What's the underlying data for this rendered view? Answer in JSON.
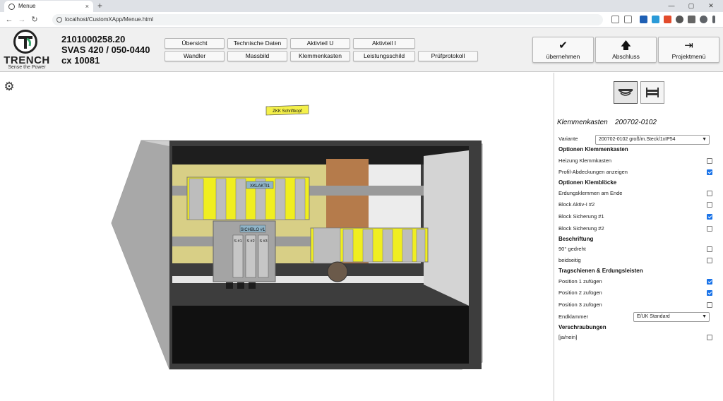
{
  "browser": {
    "tab_title": "Menue",
    "tab_close": "×",
    "new_tab": "+",
    "url": "localhost/CustomXApp/Menue.html",
    "controls": {
      "minimize": "—",
      "maximize": "▢",
      "close": "✕"
    }
  },
  "app": {
    "logo": {
      "word": "TRENCH",
      "tagline": "Sense the Power"
    },
    "ids": [
      "2101000258.20",
      "SVAS 420 / 050-0440",
      "cx 10081"
    ],
    "nav_row1": [
      "Übersicht",
      "Technische Daten",
      "Aktivteil U",
      "Aktivteil I"
    ],
    "nav_row2": [
      "Wandler",
      "Massbild",
      "Klemmenkasten",
      "Leistungsschild",
      "Prüfprotokoll"
    ],
    "actions": [
      {
        "label": "übernehmen",
        "icon": "checkmark-icon"
      },
      {
        "label": "Abschluss",
        "icon": "arrow-up-icon"
      },
      {
        "label": "Projektmenü",
        "icon": "exit-icon"
      }
    ]
  },
  "viewport": {
    "labels": {
      "tag_top": "ZKK Schriftkopf",
      "block_a": "XKLAKTI1",
      "block_b": "SICHBLO #1",
      "fuse_1": "S #1",
      "fuse_2": "S #2",
      "fuse_3": "S #3"
    }
  },
  "panel": {
    "title": "Klemmenkasten",
    "title_code": "200702-0102",
    "variante_label": "Variante",
    "variante_value": "200702-0102 groß/m.Steck/1xIP54",
    "sections": {
      "optionen": "Optionen Klemmenkasten",
      "klemmbloecke": "Optionen Klemblöcke",
      "beschriftung": "Beschriftung",
      "tragschienen": "Tragschienen & Erdungsleisten",
      "verschraubungen": "Verschraubungen"
    },
    "options": {
      "heizung": {
        "label": "Heizung Klemmkasten",
        "checked": false
      },
      "profil": {
        "label": "Profil-Abdeckungen anzeigen",
        "checked": true
      },
      "erdung": {
        "label": "Erdungsklemmen am Ende",
        "checked": false
      },
      "aktiv2": {
        "label": "Block Aktiv-I #2",
        "checked": false
      },
      "sich1": {
        "label": "Block Sicherung #1",
        "checked": true
      },
      "sich2": {
        "label": "Block Sicherung #2",
        "checked": false
      },
      "gedreht": {
        "label": "90° gedreht",
        "checked": false
      },
      "beidseitig": {
        "label": "beidseitig",
        "checked": false
      },
      "pos1": {
        "label": "Position 1 zufügen",
        "checked": true
      },
      "pos2": {
        "label": "Position 2 zufügen",
        "checked": true
      },
      "pos3": {
        "label": "Position 3 zufügen",
        "checked": false
      },
      "janein": {
        "label": "[ja/nein]",
        "checked": false
      }
    },
    "endklammer_label": "Endklammer",
    "endklammer_value": "E/UK Standard"
  }
}
